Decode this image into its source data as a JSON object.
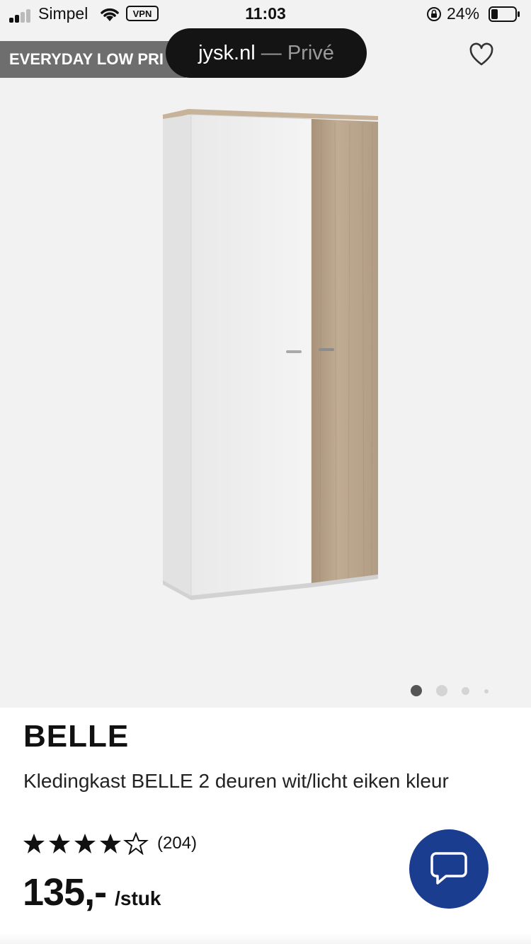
{
  "status_bar": {
    "carrier": "Simpel",
    "vpn": "VPN",
    "time": "11:03",
    "battery": "24%"
  },
  "browser": {
    "domain": "jysk.nl",
    "separator": " — ",
    "mode": "Privé"
  },
  "gallery": {
    "promo_label": "EVERYDAY LOW PRI",
    "page_count": 4,
    "active_page": 1,
    "icons": {
      "favorite": "heart-icon"
    }
  },
  "product": {
    "name": "BELLE",
    "description": "Kledingkast BELLE 2 deuren wit/licht eiken kleur",
    "rating": 4.5,
    "rating_max": 5,
    "review_count": "(204)",
    "price": "135,-",
    "price_unit": "/stuk"
  },
  "chat": {
    "icon": "chat-bubble-icon"
  },
  "colors": {
    "promo_bg": "#6e6e6e",
    "chat_button": "#1a3d8f",
    "gallery_bg": "#f2f2f2",
    "oak": "#b59d84"
  }
}
